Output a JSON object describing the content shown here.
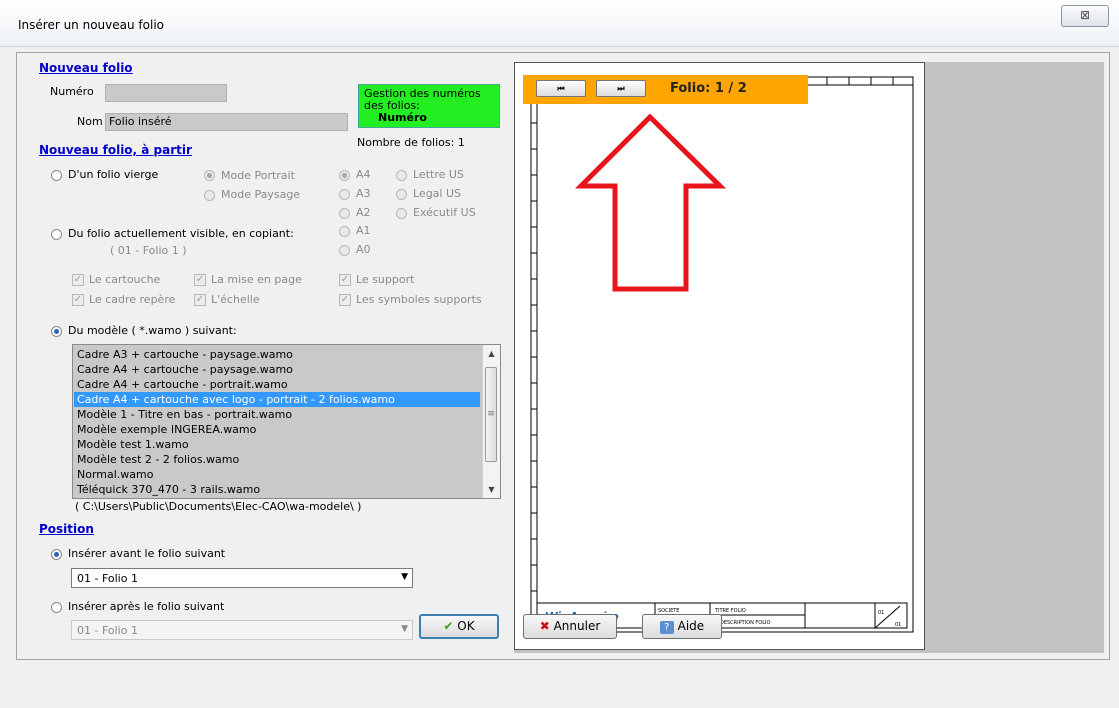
{
  "window": {
    "title": "Insérer un nouveau folio",
    "close": "⊠"
  },
  "nouveau_folio": {
    "section": "Nouveau folio",
    "numero_label": "Numéro",
    "numero_value": "",
    "nom_label": "Nom",
    "nom_value": "Folio inséré",
    "gestion_line1": "Gestion des numéros",
    "gestion_line2": "des folios:",
    "gestion_value": "Numéro",
    "nombre_folios": "Nombre de folios: 1"
  },
  "a_partir": {
    "section": "Nouveau folio, à partir",
    "vierge": "D'un folio vierge",
    "mode_portrait": "Mode Portrait",
    "mode_paysage": "Mode Paysage",
    "formats": [
      "A4",
      "A3",
      "A2",
      "A1",
      "A0"
    ],
    "formats_us": [
      "Lettre US",
      "Legal US",
      "Exécutif US"
    ],
    "copie": "Du folio actuellement visible, en copiant:",
    "copie_ref": "( 01 - Folio 1 )",
    "checks": [
      "Le cartouche",
      "La mise en page",
      "Le support",
      "Le cadre repère",
      "L'échelle",
      "Les symboles supports"
    ],
    "modele": "Du modèle ( *.wamo ) suivant:",
    "templates": [
      "Cadre A3 + cartouche - paysage.wamo",
      "Cadre A4 + cartouche - paysage.wamo",
      "Cadre A4 + cartouche - portrait.wamo",
      "Cadre A4 + cartouche avec logo - portrait - 2 folios.wamo",
      "Modèle 1 - Titre en bas - portrait.wamo",
      "Modèle exemple INGEREA.wamo",
      "Modèle test 1.wamo",
      "Modèle test 2 - 2 folios.wamo",
      "Normal.wamo",
      "Téléquick 370_470 - 3 rails.wamo"
    ],
    "selected_template": "Cadre A4 + cartouche avec logo - portrait - 2 folios.wamo",
    "path": "( C:\\Users\\Public\\Documents\\Elec-CAO\\wa-modele\\ )"
  },
  "position": {
    "section": "Position",
    "avant": "Insérer avant le folio suivant",
    "avant_value": "01 - Folio 1",
    "apres": "Insérer après le folio suivant",
    "apres_value": "01 - Folio 1"
  },
  "preview": {
    "folio_label": "Folio: 1 / 2",
    "first_icon": "⏮",
    "last_icon": "⏭",
    "logo": "WinArmoire",
    "cartouche": {
      "societe": "SOCIETE",
      "titre": "TITRE FOLIO",
      "description": "DESCRIPTION FOLIO",
      "num": "01",
      "num2": "01"
    },
    "arrow_color": "#e8141b",
    "nav_color": "#ffa500"
  },
  "buttons": {
    "ok": "OK",
    "annuler": "Annuler",
    "aide": "Aide"
  }
}
